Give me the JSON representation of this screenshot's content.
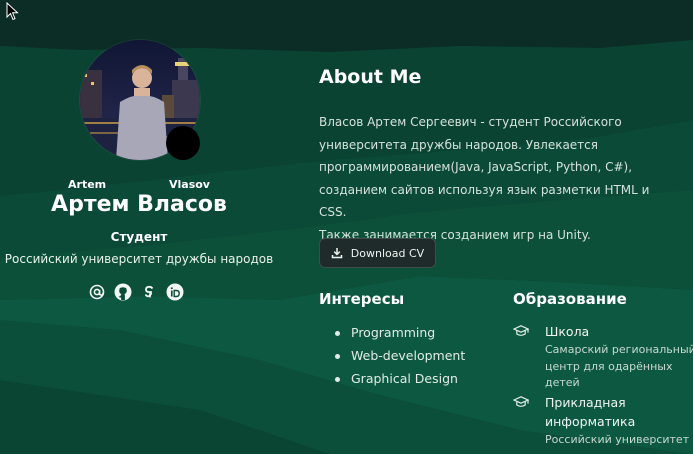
{
  "colors": {
    "background": "#0a3a2c",
    "button_bg": "#1e2b2a",
    "text_primary": "#ffffff"
  },
  "profile": {
    "first_name_en": "Artem",
    "last_name_en": "Vlasov",
    "full_name": "Артем Власов",
    "role": "Студент",
    "university": "Российский университет дружбы народов",
    "social_icons": [
      "at-sign-icon",
      "github-icon",
      "google-scholar-icon",
      "orcid-icon"
    ]
  },
  "about": {
    "title": "About Me",
    "lines": [
      "Власов Артем Сергеевич - студент Российского",
      "университета дружбы народов. Увлекается",
      "программированием(Java, JavaScript, Python, C#),",
      "созданием сайтов используя язык разметки HTML и CSS.",
      "Также занимается созданием игр на Unity."
    ],
    "download_label": "Download CV"
  },
  "interests": {
    "title": "Интересы",
    "items": [
      "Programming",
      "Web-development",
      "Graphical Design"
    ]
  },
  "education": {
    "title": "Образование",
    "items": [
      {
        "title": "Школа",
        "sub": [
          "Самарский региональный",
          "центр для одарённых",
          "детей"
        ]
      },
      {
        "title": [
          "Прикладная",
          "информатика"
        ],
        "sub": [
          "Российский университет"
        ]
      }
    ]
  }
}
